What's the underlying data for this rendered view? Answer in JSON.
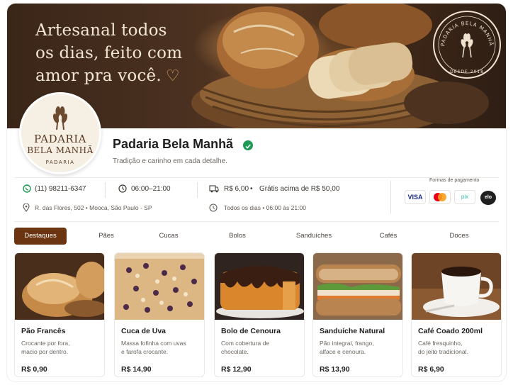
{
  "hero": {
    "tagline_line1": "Artesanal todos",
    "tagline_line2": "os dias, feito com",
    "tagline_line3": "amor pra você.",
    "seal_text": "PADARIA BELA MANHÃ",
    "seal_since": "DESDE 2018"
  },
  "logo": {
    "line1": "PADARIA",
    "line2": "BELA MANHÃ",
    "line3": "PADARIA"
  },
  "shop": {
    "name": "Padaria Bela Manhã",
    "subtitle": "Tradição e carinho em cada detalhe."
  },
  "info": {
    "phone": "(11) 98211-6347",
    "address": "R. das Flores, 502  •  Mooca, São Paulo - SP",
    "hours": "06:00–21:00",
    "delivery_fee": "R$ 6,00",
    "free_delivery": "Grátis acima de R$ 50,00",
    "schedule": "Todos os dias  •  06:00 às 21:00"
  },
  "payment": {
    "title": "Formas de pagamento",
    "methods": [
      "VISA",
      "mastercard",
      "pix",
      "elo"
    ]
  },
  "tabs": [
    {
      "label": "Destaques",
      "active": true
    },
    {
      "label": "Pães",
      "active": false
    },
    {
      "label": "Cucas",
      "active": false
    },
    {
      "label": "Bolos",
      "active": false
    },
    {
      "label": "Sanduíches",
      "active": false
    },
    {
      "label": "Cafés",
      "active": false
    },
    {
      "label": "Doces",
      "active": false
    }
  ],
  "products": [
    {
      "name": "Pão Francês",
      "desc_line1": "Crocante por fora,",
      "desc_line2": "macio por dentro.",
      "price": "R$ 0,90"
    },
    {
      "name": "Cuca de Uva",
      "desc_line1": "Massa fofinha com uvas",
      "desc_line2": "e farofa crocante.",
      "price": "R$ 14,90"
    },
    {
      "name": "Bolo de Cenoura",
      "desc_line1": "Com cobertura de",
      "desc_line2": "chocolate.",
      "price": "R$ 12,90"
    },
    {
      "name": "Sanduíche Natural",
      "desc_line1": "Pão integral, frango,",
      "desc_line2": "alface e cenoura.",
      "price": "R$ 13,90"
    },
    {
      "name": "Café Coado 200ml",
      "desc_line1": "Café fresquinho,",
      "desc_line2": "do jeito tradicional.",
      "price": "R$ 6,90"
    }
  ],
  "colors": {
    "accent": "#6b3512",
    "verified": "#1f9a55",
    "hero_text": "#f3e6d3"
  }
}
